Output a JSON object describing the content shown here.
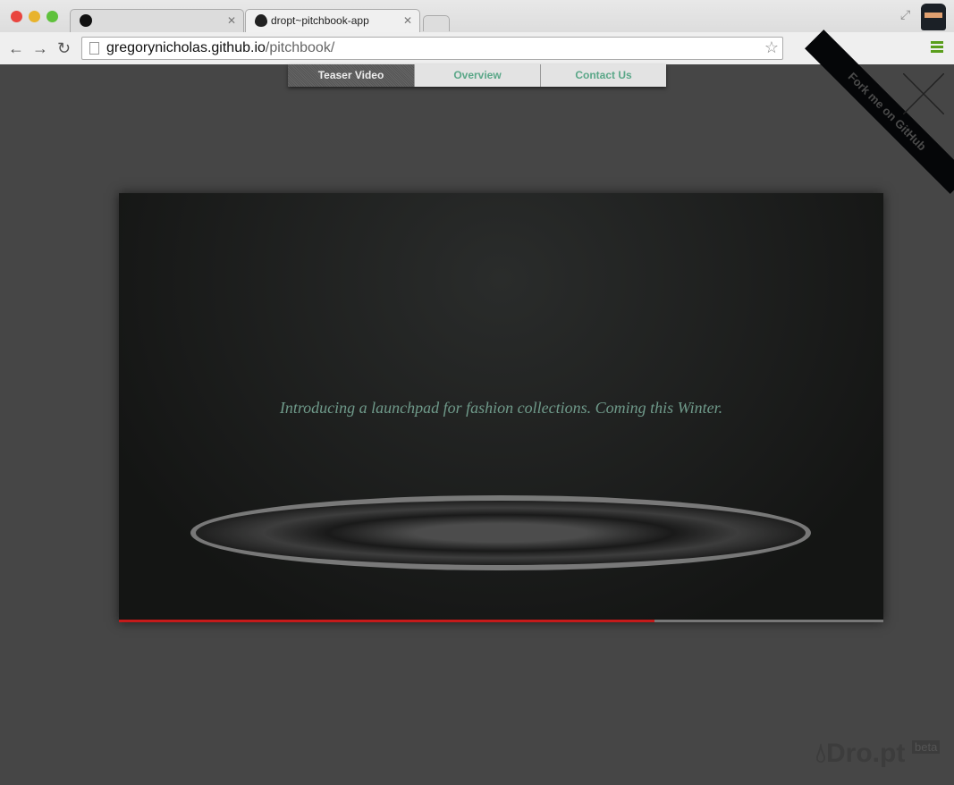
{
  "browser": {
    "tabs": [
      {
        "label": "",
        "icon": "github-icon"
      },
      {
        "label": "dropt~pitchbook-app",
        "icon": "drop-icon"
      }
    ],
    "url_host": "gregorynicholas.github.io",
    "url_path": "/pitchbook/"
  },
  "nav": {
    "items": [
      {
        "label": "Teaser Video",
        "active": true
      },
      {
        "label": "Overview"
      },
      {
        "label": "Contact Us"
      }
    ]
  },
  "video": {
    "caption": "Introducing a launchpad for fashion collections. Coming this Winter.",
    "progress": 0.7,
    "progress_color": "#c41a1a"
  },
  "ribbon": {
    "label": "Fork me on GitHub"
  },
  "logo": {
    "text": "Dro.pt",
    "badge": "beta"
  }
}
